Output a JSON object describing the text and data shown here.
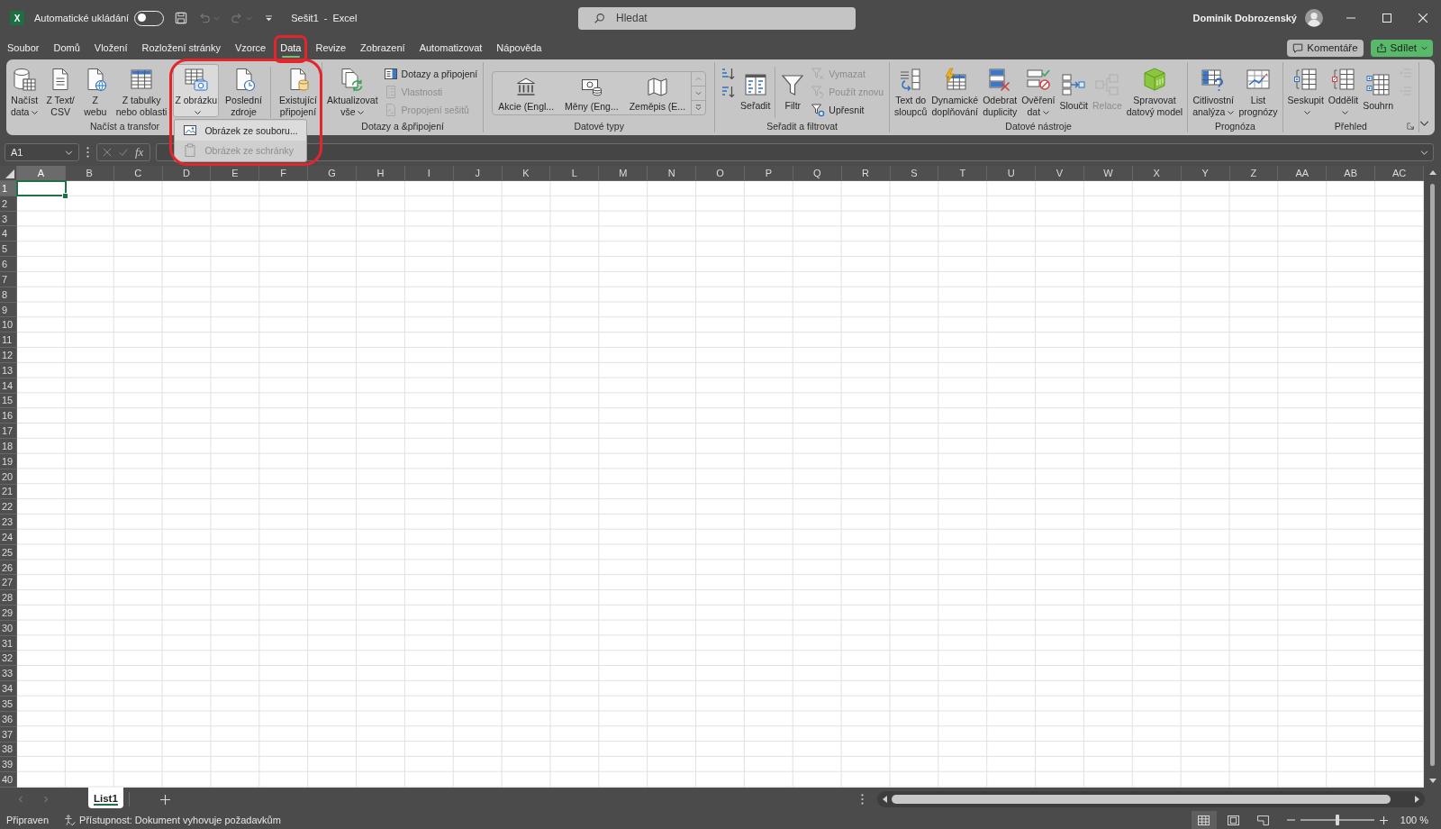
{
  "title_bar": {
    "app_logo": "X",
    "autosave_label": "Automatické ukládání",
    "autosave": {
      "on": false
    },
    "document_title": "Sešit1 - Excel",
    "search": {
      "placeholder": "Hledat"
    },
    "user_name": "Dominik Dobrozenský"
  },
  "tabs": [
    {
      "label": "Soubor",
      "selected": false,
      "outlined": false
    },
    {
      "label": "Domů",
      "selected": false,
      "outlined": false
    },
    {
      "label": "Vložení",
      "selected": false,
      "outlined": false
    },
    {
      "label": "Rozložení stránky",
      "selected": false,
      "outlined": false
    },
    {
      "label": "Vzorce",
      "selected": false,
      "outlined": false
    },
    {
      "label": "Data",
      "selected": true,
      "outlined": true
    },
    {
      "label": "Revize",
      "selected": false,
      "outlined": false
    },
    {
      "label": "Zobrazení",
      "selected": false,
      "outlined": false
    },
    {
      "label": "Automatizovat",
      "selected": false,
      "outlined": false
    },
    {
      "label": "Nápověda",
      "selected": false,
      "outlined": false
    }
  ],
  "tab_bar_buttons": [
    {
      "kind": "comments",
      "label": "Komentáře"
    },
    {
      "kind": "share",
      "label": "Sdílet"
    }
  ],
  "ribbon": {
    "groups": [
      {
        "label": "Načíst a transfor",
        "items": [
          {
            "kind": "large",
            "lines": [
              "Načíst",
              "data"
            ],
            "dropdown": true,
            "disabled": false,
            "expanded": false
          },
          {
            "kind": "large",
            "lines": [
              "Z Text/",
              "CSV"
            ],
            "dropdown": false,
            "disabled": false,
            "expanded": false
          },
          {
            "kind": "large",
            "lines": [
              "Z",
              "webu"
            ],
            "dropdown": false,
            "disabled": false,
            "expanded": false
          },
          {
            "kind": "large",
            "lines": [
              "Z tabulky",
              "nebo oblasti"
            ],
            "dropdown": false,
            "disabled": false,
            "expanded": false
          },
          {
            "kind": "large",
            "lines": [
              "Z obrázku"
            ],
            "dropdown": true,
            "disabled": false,
            "expanded": true,
            "menu": [
              {
                "label": "Obrázek ze souboru...",
                "disabled": false,
                "highlighted": true
              },
              {
                "label": "Obrázek ze schránky",
                "disabled": true,
                "highlighted": false
              }
            ]
          },
          {
            "kind": "large",
            "lines": [
              "Poslední",
              "zdroje"
            ],
            "dropdown": false,
            "disabled": false,
            "expanded": false
          },
          {
            "kind": "separator"
          },
          {
            "kind": "large",
            "lines": [
              "Existující",
              "připojení"
            ],
            "dropdown": false,
            "disabled": false,
            "expanded": false
          }
        ]
      },
      {
        "label": "Dotazy a &připojení",
        "items": [
          {
            "kind": "large",
            "lines": [
              "Aktualizovat",
              "vše"
            ],
            "dropdown": true,
            "disabled": false,
            "expanded": false
          },
          {
            "kind": "stack",
            "buttons": [
              {
                "label": "Dotazy a připojení",
                "disabled": false
              },
              {
                "label": "Vlastnosti",
                "disabled": true
              },
              {
                "label": "Propojení sešitů",
                "disabled": true
              }
            ]
          }
        ]
      },
      {
        "label": "Datové typy",
        "items": [
          {
            "kind": "gallery",
            "entries": [
              "Akcie (Engl...",
              "Měny (Eng...",
              "Zeměpis (E..."
            ]
          }
        ]
      },
      {
        "label": "Seřadit a filtrovat",
        "items": [
          {
            "kind": "stack",
            "buttons": [
              {
                "disabled": false
              },
              {
                "disabled": false
              }
            ]
          },
          {
            "kind": "large",
            "lines": [
              "Seřadit"
            ],
            "dropdown": false,
            "disabled": false,
            "expanded": false
          },
          {
            "kind": "separator"
          },
          {
            "kind": "large",
            "lines": [
              "Filtr"
            ],
            "dropdown": false,
            "disabled": false,
            "expanded": false
          },
          {
            "kind": "stack",
            "buttons": [
              {
                "label": "Vymazat",
                "disabled": true
              },
              {
                "label": "Použít znovu",
                "disabled": true
              },
              {
                "label": "Upřesnit",
                "disabled": false
              }
            ]
          }
        ]
      },
      {
        "label": "Datové nástroje",
        "items": [
          {
            "kind": "large",
            "lines": [
              "Text do",
              "sloupců"
            ],
            "dropdown": false,
            "disabled": false,
            "expanded": false
          },
          {
            "kind": "large",
            "lines": [
              "Dynamické",
              "doplňování"
            ],
            "dropdown": false,
            "disabled": false,
            "expanded": false
          },
          {
            "kind": "large",
            "lines": [
              "Odebrat",
              "duplicity"
            ],
            "dropdown": false,
            "disabled": false,
            "expanded": false
          },
          {
            "kind": "large",
            "lines": [
              "Ověření",
              "dat"
            ],
            "dropdown": true,
            "disabled": false,
            "expanded": false
          },
          {
            "kind": "large",
            "lines": [
              "Sloučit"
            ],
            "dropdown": false,
            "disabled": false,
            "expanded": false
          },
          {
            "kind": "large",
            "lines": [
              "Relace"
            ],
            "dropdown": false,
            "disabled": true,
            "expanded": false
          },
          {
            "kind": "large",
            "lines": [
              "Spravovat",
              "datový model"
            ],
            "dropdown": false,
            "disabled": false,
            "expanded": false
          }
        ]
      },
      {
        "label": "Prognóza",
        "items": [
          {
            "kind": "large",
            "lines": [
              "Citlivostní",
              "analýza"
            ],
            "dropdown": true,
            "disabled": false,
            "expanded": false
          },
          {
            "kind": "large",
            "lines": [
              "List",
              "prognózy"
            ],
            "dropdown": false,
            "disabled": false,
            "expanded": false
          }
        ]
      },
      {
        "label": "Přehled",
        "items": [
          {
            "kind": "large",
            "lines": [
              "Seskupit"
            ],
            "dropdown": true,
            "disabled": false,
            "expanded": false
          },
          {
            "kind": "large",
            "lines": [
              "Oddělit"
            ],
            "dropdown": true,
            "disabled": false,
            "expanded": false
          },
          {
            "kind": "large",
            "lines": [
              "Souhrn"
            ],
            "dropdown": false,
            "disabled": false,
            "expanded": false
          },
          {
            "kind": "stack",
            "buttons": [
              {
                "disabled": true
              },
              {
                "disabled": true
              }
            ]
          }
        ]
      }
    ]
  },
  "formula_bar": {
    "name_box": "A1",
    "function_button": "fx"
  },
  "sheet": {
    "columns": [
      {
        "label": "A",
        "selected": true
      },
      {
        "label": "B",
        "selected": false
      },
      {
        "label": "C",
        "selected": false
      },
      {
        "label": "D",
        "selected": false
      },
      {
        "label": "E",
        "selected": false
      },
      {
        "label": "F",
        "selected": false
      },
      {
        "label": "G",
        "selected": false
      },
      {
        "label": "H",
        "selected": false
      },
      {
        "label": "I",
        "selected": false
      },
      {
        "label": "J",
        "selected": false
      },
      {
        "label": "K",
        "selected": false
      },
      {
        "label": "L",
        "selected": false
      },
      {
        "label": "M",
        "selected": false
      },
      {
        "label": "N",
        "selected": false
      },
      {
        "label": "O",
        "selected": false
      },
      {
        "label": "P",
        "selected": false
      },
      {
        "label": "Q",
        "selected": false
      },
      {
        "label": "R",
        "selected": false
      },
      {
        "label": "S",
        "selected": false
      },
      {
        "label": "T",
        "selected": false
      },
      {
        "label": "U",
        "selected": false
      },
      {
        "label": "V",
        "selected": false
      },
      {
        "label": "W",
        "selected": false
      },
      {
        "label": "X",
        "selected": false
      },
      {
        "label": "Y",
        "selected": false
      },
      {
        "label": "Z",
        "selected": false
      },
      {
        "label": "AA",
        "selected": false
      },
      {
        "label": "AB",
        "selected": false
      },
      {
        "label": "AC",
        "selected": false
      }
    ],
    "rows": [
      {
        "label": "1",
        "selected": true
      },
      {
        "label": "2",
        "selected": false
      },
      {
        "label": "3",
        "selected": false
      },
      {
        "label": "4",
        "selected": false
      },
      {
        "label": "5",
        "selected": false
      },
      {
        "label": "6",
        "selected": false
      },
      {
        "label": "7",
        "selected": false
      },
      {
        "label": "8",
        "selected": false
      },
      {
        "label": "9",
        "selected": false
      },
      {
        "label": "10",
        "selected": false
      },
      {
        "label": "11",
        "selected": false
      },
      {
        "label": "12",
        "selected": false
      },
      {
        "label": "13",
        "selected": false
      },
      {
        "label": "14",
        "selected": false
      },
      {
        "label": "15",
        "selected": false
      },
      {
        "label": "16",
        "selected": false
      },
      {
        "label": "17",
        "selected": false
      },
      {
        "label": "18",
        "selected": false
      },
      {
        "label": "19",
        "selected": false
      },
      {
        "label": "20",
        "selected": false
      },
      {
        "label": "21",
        "selected": false
      },
      {
        "label": "22",
        "selected": false
      },
      {
        "label": "23",
        "selected": false
      },
      {
        "label": "24",
        "selected": false
      },
      {
        "label": "25",
        "selected": false
      },
      {
        "label": "26",
        "selected": false
      },
      {
        "label": "27",
        "selected": false
      },
      {
        "label": "28",
        "selected": false
      },
      {
        "label": "29",
        "selected": false
      },
      {
        "label": "30",
        "selected": false
      },
      {
        "label": "31",
        "selected": false
      },
      {
        "label": "32",
        "selected": false
      },
      {
        "label": "33",
        "selected": false
      },
      {
        "label": "34",
        "selected": false
      },
      {
        "label": "35",
        "selected": false
      },
      {
        "label": "36",
        "selected": false
      },
      {
        "label": "37",
        "selected": false
      },
      {
        "label": "38",
        "selected": false
      },
      {
        "label": "39",
        "selected": false
      },
      {
        "label": "40",
        "selected": false
      }
    ]
  },
  "sheet_tabs": [
    {
      "label": "List1",
      "selected": true
    }
  ],
  "status_bar": {
    "status": "Připraven",
    "accessibility": "Přístupnost: Dokument vyhovuje požadavkům",
    "views": [
      {
        "selected": true
      },
      {
        "selected": false
      },
      {
        "selected": false
      }
    ],
    "zoom": {
      "level": 0.5,
      "reading": "100 %"
    }
  }
}
